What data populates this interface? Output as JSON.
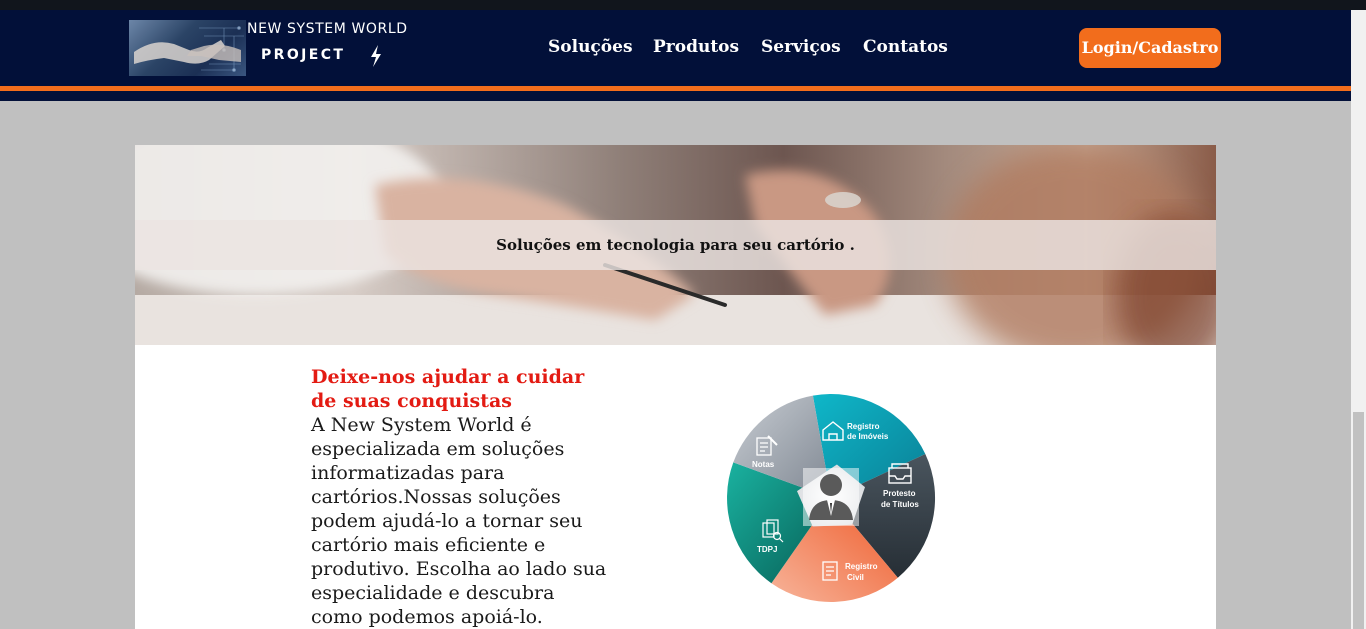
{
  "header": {
    "logo_title": "NEW SYSTEM WORLD",
    "logo_subtitle": "PROJECT",
    "nav": [
      "Soluções",
      "Produtos",
      "Serviços",
      "Contatos"
    ],
    "login_label": "Login/Cadastro"
  },
  "hero": {
    "tagline": "Soluções em tecnologia para seu cartório ."
  },
  "main": {
    "heading": "Deixe-nos ajudar a cuidar de suas conquistas",
    "paragraph": "A New System World é especializada em soluções informatizadas para cartórios.Nossas soluções podem ajudá-lo a tornar seu cartório mais eficiente e produtivo. Escolha ao lado sua especialidade e descubra como podemos apoiá-lo."
  },
  "wheel": {
    "segments": [
      {
        "line1": "Registro",
        "line2": "de Imóveis",
        "color": "#11a7b8",
        "icon": "house-icon"
      },
      {
        "line1": "Protesto",
        "line2": "de Títulos",
        "color": "#3b464f",
        "icon": "tray-icon"
      },
      {
        "line1": "Registro",
        "line2": "Civil",
        "color": "#f27a4d",
        "icon": "certificate-icon"
      },
      {
        "line1": "TDPJ",
        "line2": "",
        "color": "#0b8f7f",
        "icon": "documents-search-icon"
      },
      {
        "line1": "Notas",
        "line2": "",
        "color": "#a4aab2",
        "icon": "notes-icon"
      }
    ],
    "center_icon": "person-icon"
  },
  "colors": {
    "navy": "#021039",
    "accent": "#f26d1c",
    "heading": "#e31b13"
  }
}
